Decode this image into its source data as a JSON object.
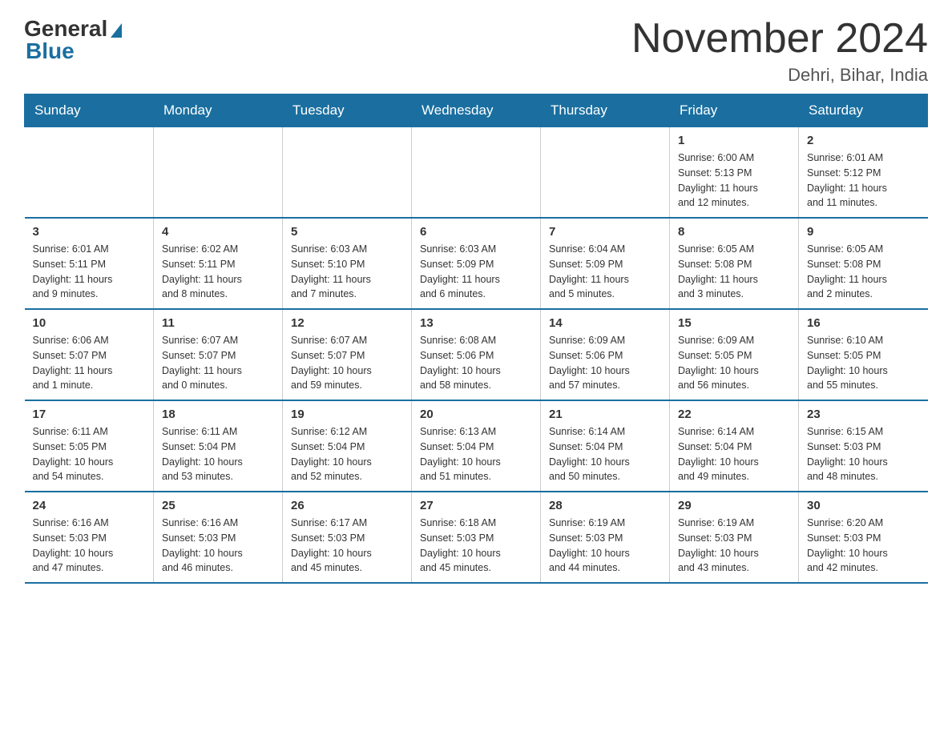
{
  "header": {
    "logo": {
      "general": "General",
      "blue": "Blue"
    },
    "title": "November 2024",
    "location": "Dehri, Bihar, India"
  },
  "weekdays": [
    "Sunday",
    "Monday",
    "Tuesday",
    "Wednesday",
    "Thursday",
    "Friday",
    "Saturday"
  ],
  "weeks": [
    [
      {
        "day": "",
        "info": ""
      },
      {
        "day": "",
        "info": ""
      },
      {
        "day": "",
        "info": ""
      },
      {
        "day": "",
        "info": ""
      },
      {
        "day": "",
        "info": ""
      },
      {
        "day": "1",
        "info": "Sunrise: 6:00 AM\nSunset: 5:13 PM\nDaylight: 11 hours\nand 12 minutes."
      },
      {
        "day": "2",
        "info": "Sunrise: 6:01 AM\nSunset: 5:12 PM\nDaylight: 11 hours\nand 11 minutes."
      }
    ],
    [
      {
        "day": "3",
        "info": "Sunrise: 6:01 AM\nSunset: 5:11 PM\nDaylight: 11 hours\nand 9 minutes."
      },
      {
        "day": "4",
        "info": "Sunrise: 6:02 AM\nSunset: 5:11 PM\nDaylight: 11 hours\nand 8 minutes."
      },
      {
        "day": "5",
        "info": "Sunrise: 6:03 AM\nSunset: 5:10 PM\nDaylight: 11 hours\nand 7 minutes."
      },
      {
        "day": "6",
        "info": "Sunrise: 6:03 AM\nSunset: 5:09 PM\nDaylight: 11 hours\nand 6 minutes."
      },
      {
        "day": "7",
        "info": "Sunrise: 6:04 AM\nSunset: 5:09 PM\nDaylight: 11 hours\nand 5 minutes."
      },
      {
        "day": "8",
        "info": "Sunrise: 6:05 AM\nSunset: 5:08 PM\nDaylight: 11 hours\nand 3 minutes."
      },
      {
        "day": "9",
        "info": "Sunrise: 6:05 AM\nSunset: 5:08 PM\nDaylight: 11 hours\nand 2 minutes."
      }
    ],
    [
      {
        "day": "10",
        "info": "Sunrise: 6:06 AM\nSunset: 5:07 PM\nDaylight: 11 hours\nand 1 minute."
      },
      {
        "day": "11",
        "info": "Sunrise: 6:07 AM\nSunset: 5:07 PM\nDaylight: 11 hours\nand 0 minutes."
      },
      {
        "day": "12",
        "info": "Sunrise: 6:07 AM\nSunset: 5:07 PM\nDaylight: 10 hours\nand 59 minutes."
      },
      {
        "day": "13",
        "info": "Sunrise: 6:08 AM\nSunset: 5:06 PM\nDaylight: 10 hours\nand 58 minutes."
      },
      {
        "day": "14",
        "info": "Sunrise: 6:09 AM\nSunset: 5:06 PM\nDaylight: 10 hours\nand 57 minutes."
      },
      {
        "day": "15",
        "info": "Sunrise: 6:09 AM\nSunset: 5:05 PM\nDaylight: 10 hours\nand 56 minutes."
      },
      {
        "day": "16",
        "info": "Sunrise: 6:10 AM\nSunset: 5:05 PM\nDaylight: 10 hours\nand 55 minutes."
      }
    ],
    [
      {
        "day": "17",
        "info": "Sunrise: 6:11 AM\nSunset: 5:05 PM\nDaylight: 10 hours\nand 54 minutes."
      },
      {
        "day": "18",
        "info": "Sunrise: 6:11 AM\nSunset: 5:04 PM\nDaylight: 10 hours\nand 53 minutes."
      },
      {
        "day": "19",
        "info": "Sunrise: 6:12 AM\nSunset: 5:04 PM\nDaylight: 10 hours\nand 52 minutes."
      },
      {
        "day": "20",
        "info": "Sunrise: 6:13 AM\nSunset: 5:04 PM\nDaylight: 10 hours\nand 51 minutes."
      },
      {
        "day": "21",
        "info": "Sunrise: 6:14 AM\nSunset: 5:04 PM\nDaylight: 10 hours\nand 50 minutes."
      },
      {
        "day": "22",
        "info": "Sunrise: 6:14 AM\nSunset: 5:04 PM\nDaylight: 10 hours\nand 49 minutes."
      },
      {
        "day": "23",
        "info": "Sunrise: 6:15 AM\nSunset: 5:03 PM\nDaylight: 10 hours\nand 48 minutes."
      }
    ],
    [
      {
        "day": "24",
        "info": "Sunrise: 6:16 AM\nSunset: 5:03 PM\nDaylight: 10 hours\nand 47 minutes."
      },
      {
        "day": "25",
        "info": "Sunrise: 6:16 AM\nSunset: 5:03 PM\nDaylight: 10 hours\nand 46 minutes."
      },
      {
        "day": "26",
        "info": "Sunrise: 6:17 AM\nSunset: 5:03 PM\nDaylight: 10 hours\nand 45 minutes."
      },
      {
        "day": "27",
        "info": "Sunrise: 6:18 AM\nSunset: 5:03 PM\nDaylight: 10 hours\nand 45 minutes."
      },
      {
        "day": "28",
        "info": "Sunrise: 6:19 AM\nSunset: 5:03 PM\nDaylight: 10 hours\nand 44 minutes."
      },
      {
        "day": "29",
        "info": "Sunrise: 6:19 AM\nSunset: 5:03 PM\nDaylight: 10 hours\nand 43 minutes."
      },
      {
        "day": "30",
        "info": "Sunrise: 6:20 AM\nSunset: 5:03 PM\nDaylight: 10 hours\nand 42 minutes."
      }
    ]
  ]
}
